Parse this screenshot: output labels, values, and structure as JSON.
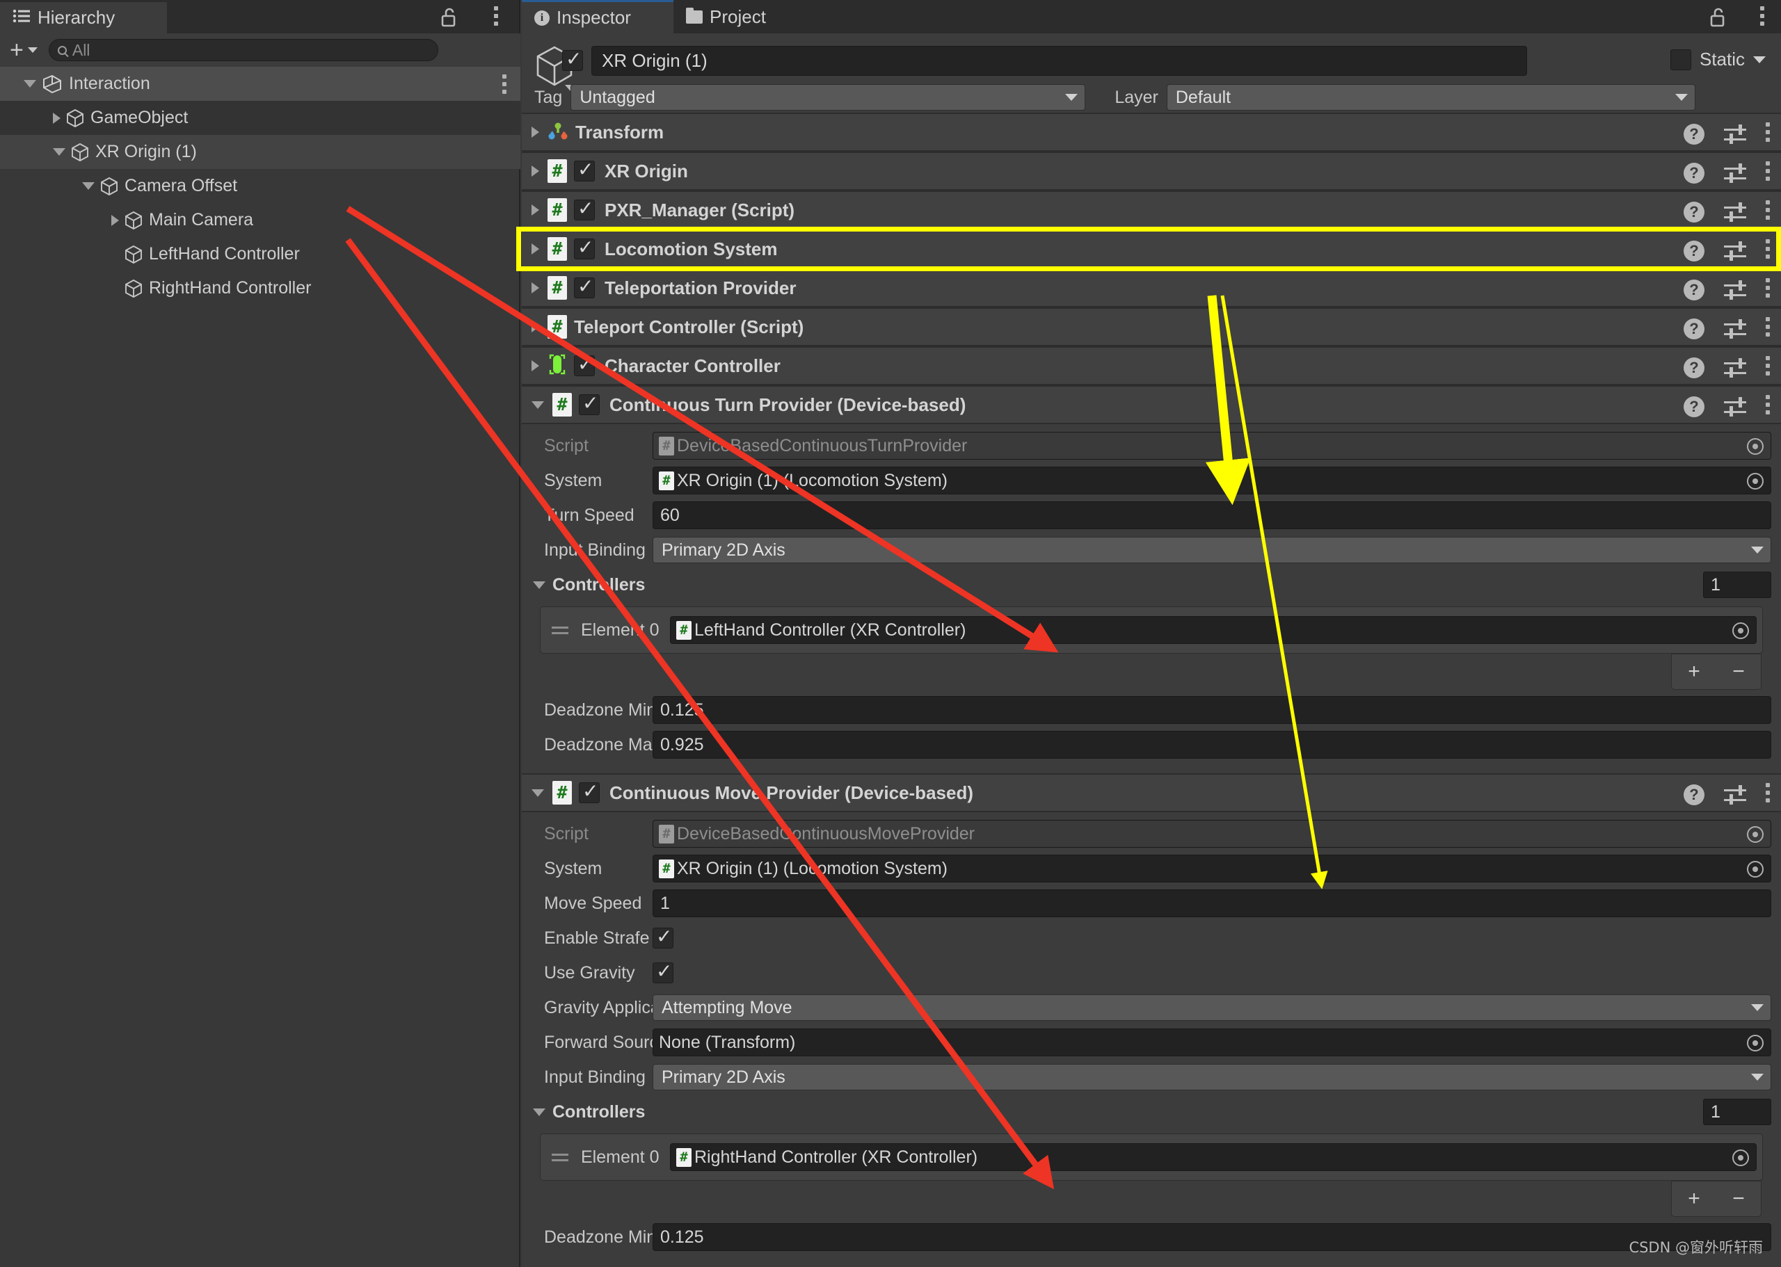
{
  "hierarchy": {
    "tab_label": "Hierarchy",
    "tab_icon": "list-icon",
    "lock_icon": "lock-open-icon",
    "menu_icon": "kebab-menu-icon",
    "add_button_label": "+",
    "search": {
      "placeholder": "All",
      "value": "",
      "icon": "search-icon"
    },
    "items": [
      {
        "label": "Interaction",
        "indent": 0,
        "arrow": "open",
        "icon": "unity-logo-icon",
        "state": "selected-header",
        "has_menu": true
      },
      {
        "label": "GameObject",
        "indent": 1,
        "arrow": "closed",
        "icon": "gameobject-cube-icon",
        "state": "zebra",
        "has_menu": false
      },
      {
        "label": "XR Origin (1)",
        "indent": 1,
        "arrow": "open",
        "icon": "gameobject-cube-icon",
        "state": "selected",
        "has_menu": false
      },
      {
        "label": "Camera Offset",
        "indent": 2,
        "arrow": "open",
        "icon": "gameobject-cube-icon",
        "state": "normal",
        "has_menu": false
      },
      {
        "label": "Main Camera",
        "indent": 3,
        "arrow": "closed",
        "icon": "gameobject-cube-icon",
        "state": "normal",
        "has_menu": false
      },
      {
        "label": "LeftHand Controller",
        "indent": 3,
        "arrow": "none",
        "icon": "gameobject-cube-icon",
        "state": "normal",
        "has_menu": false
      },
      {
        "label": "RightHand Controller",
        "indent": 3,
        "arrow": "none",
        "icon": "gameobject-cube-icon",
        "state": "normal",
        "has_menu": false
      }
    ]
  },
  "inspector": {
    "tabs": [
      {
        "label": "Inspector",
        "icon": "info-icon",
        "active": true
      },
      {
        "label": "Project",
        "icon": "folder-icon",
        "active": false
      }
    ],
    "lock_icon": "lock-open-icon",
    "menu_icon": "kebab-menu-icon",
    "gameobject": {
      "enabled": true,
      "name": "XR Origin (1)",
      "static_label": "Static",
      "static_checked": false,
      "tag_label": "Tag",
      "tag_value": "Untagged",
      "layer_label": "Layer",
      "layer_value": "Default"
    },
    "components": [
      {
        "name": "Transform",
        "icon": "transform-axis-icon",
        "expanded": false,
        "has_checkbox": false,
        "checked": false,
        "highlighted": false
      },
      {
        "name": "XR Origin",
        "icon": "script-icon",
        "expanded": false,
        "has_checkbox": true,
        "checked": true,
        "highlighted": false
      },
      {
        "name": "PXR_Manager (Script)",
        "icon": "script-icon",
        "expanded": false,
        "has_checkbox": true,
        "checked": true,
        "highlighted": false
      },
      {
        "name": "Locomotion System",
        "icon": "script-icon",
        "expanded": false,
        "has_checkbox": true,
        "checked": true,
        "highlighted": true
      },
      {
        "name": "Teleportation Provider",
        "icon": "script-icon",
        "expanded": false,
        "has_checkbox": true,
        "checked": true,
        "highlighted": false
      },
      {
        "name": "Teleport Controller (Script)",
        "icon": "script-icon",
        "expanded": false,
        "has_checkbox": false,
        "checked": false,
        "highlighted": false
      },
      {
        "name": "Character Controller",
        "icon": "capsule-collider-icon",
        "expanded": false,
        "has_checkbox": true,
        "checked": true,
        "highlighted": false
      },
      {
        "name": "Continuous Turn Provider (Device-based)",
        "icon": "script-icon",
        "expanded": true,
        "has_checkbox": true,
        "checked": true,
        "highlighted": false
      },
      {
        "name": "Continuous Move Provider (Device-based)",
        "icon": "script-icon",
        "expanded": true,
        "has_checkbox": true,
        "checked": true,
        "highlighted": false
      }
    ],
    "row_actions": {
      "help_icon": "help-question-icon",
      "preset_icon": "preset-sliders-icon",
      "menu_icon": "kebab-menu-icon"
    },
    "turn_provider": {
      "script_label": "Script",
      "script_value": "DeviceBasedContinuousTurnProvider",
      "system_label": "System",
      "system_value": "XR Origin (1) (Locomotion System)",
      "turn_speed_label": "Turn Speed",
      "turn_speed_value": "60",
      "input_binding_label": "Input Binding",
      "input_binding_value": "Primary 2D Axis",
      "controllers_label": "Controllers",
      "controllers_size": "1",
      "element_label": "Element 0",
      "element_value": "LeftHand Controller (XR Controller)",
      "add_label": "+",
      "remove_label": "−",
      "deadzone_min_label": "Deadzone Min",
      "deadzone_min_value": "0.125",
      "deadzone_max_label": "Deadzone Max",
      "deadzone_max_value": "0.925"
    },
    "move_provider": {
      "script_label": "Script",
      "script_value": "DeviceBasedContinuousMoveProvider",
      "system_label": "System",
      "system_value": "XR Origin (1) (Locomotion System)",
      "move_speed_label": "Move Speed",
      "move_speed_value": "1",
      "enable_strafe_label": "Enable Strafe",
      "enable_strafe_checked": true,
      "use_gravity_label": "Use Gravity",
      "use_gravity_checked": true,
      "gravity_mode_label": "Gravity Application Mode",
      "gravity_mode_value": "Attempting Move",
      "forward_source_label": "Forward Source",
      "forward_source_value": "None (Transform)",
      "input_binding_label": "Input Binding",
      "input_binding_value": "Primary 2D Axis",
      "controllers_label": "Controllers",
      "controllers_size": "1",
      "element_label": "Element 0",
      "element_value": "RightHand Controller (XR Controller)",
      "add_label": "+",
      "remove_label": "−",
      "deadzone_min_label": "Deadzone Min",
      "deadzone_min_value": "0.125"
    }
  },
  "annotations": {
    "highlight_color": "#ffff00",
    "arrow_red_color": "#ee3424",
    "arrow_yellow_color": "#ffff00"
  },
  "watermark": {
    "text": "CSDN @窗外听轩雨"
  }
}
